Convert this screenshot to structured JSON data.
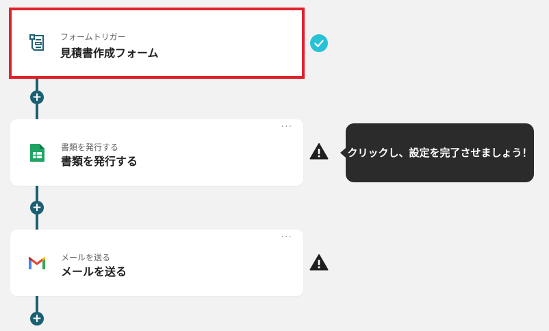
{
  "steps": [
    {
      "subtitle": "フォームトリガー",
      "title": "見積書作成フォーム",
      "icon": "form-icon",
      "status": "complete"
    },
    {
      "subtitle": "書類を発行する",
      "title": "書類を発行する",
      "icon": "google-sheets-icon",
      "status": "warning"
    },
    {
      "subtitle": "メールを送る",
      "title": "メールを送る",
      "icon": "gmail-icon",
      "status": "warning"
    }
  ],
  "add_symbol": "+",
  "more_symbol": "···",
  "tooltip": {
    "text": "クリックし、設定を完了させましょう！"
  },
  "colors": {
    "connector": "#1b5f73",
    "selected_border": "#e0212b",
    "check": "#27c2d6",
    "tooltip_bg": "#2b2b2b"
  }
}
